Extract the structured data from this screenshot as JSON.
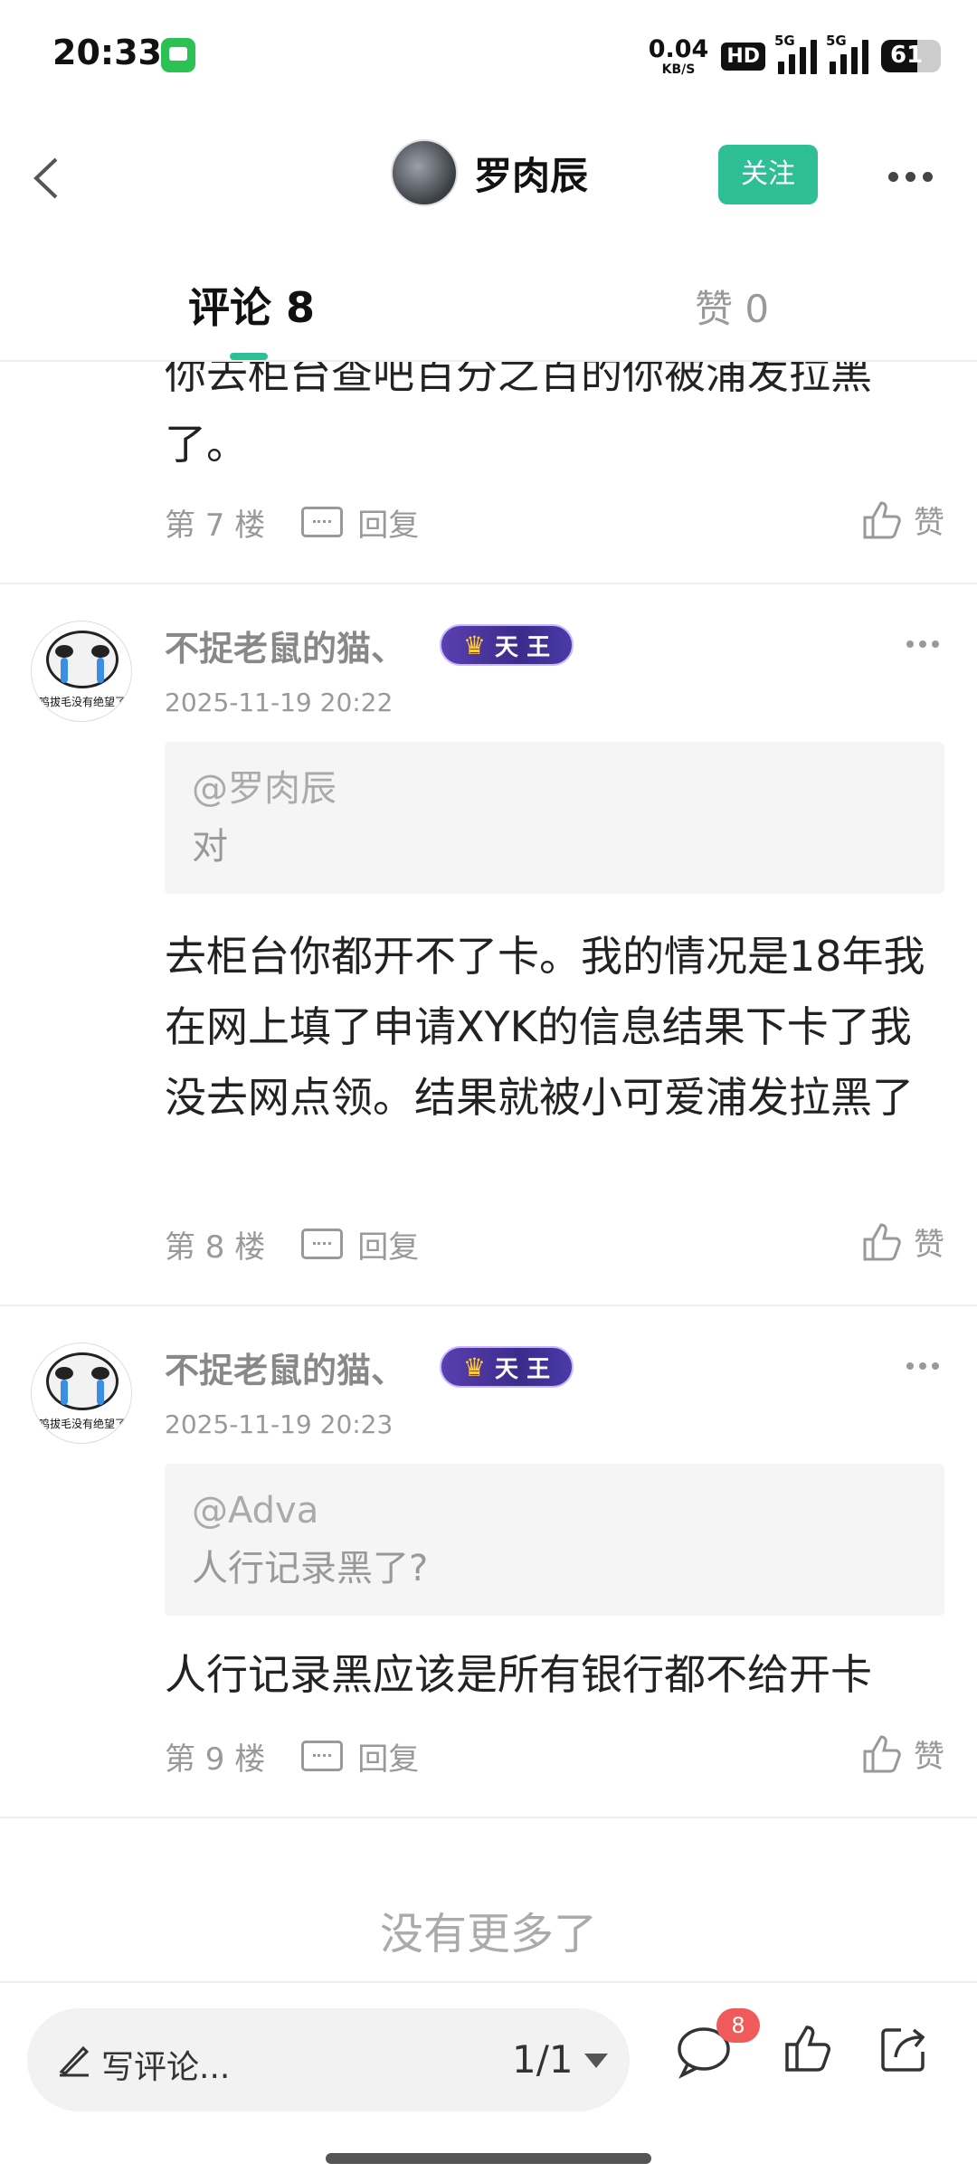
{
  "status_bar": {
    "time": "20:33",
    "net_speed": "0.04",
    "net_unit": "KB/S",
    "hd": "HD",
    "sim1": "5G",
    "sim2": "5G",
    "battery": "61",
    "battery_level": 0.61
  },
  "header": {
    "username": "罗肉辰",
    "follow_label": "关注"
  },
  "tabs": {
    "comments": "评论 8",
    "likes": "赞 0"
  },
  "comments": [
    {
      "body_partial": "你去柜台查吧百分之百的你被浦发拉黑了。",
      "floor": "第 7 楼",
      "reply_label": "回复",
      "like_label": "赞"
    },
    {
      "author": "不捉老鼠的猫、",
      "badge": "天 王",
      "date": "2025-11-19 20:22",
      "quote_user": "@罗肉辰",
      "quote_text": "对",
      "body": "去柜台你都开不了卡。我的情况是18年我在网上填了申请XYK的信息结果下卡了我没去网点领。结果就被小可爱浦发拉黑了",
      "floor": "第 8 楼",
      "reply_label": "回复",
      "like_label": "赞",
      "avatar_caption": "鸣拔毛没有绝望了"
    },
    {
      "author": "不捉老鼠的猫、",
      "badge": "天 王",
      "date": "2025-11-19 20:23",
      "quote_user": "@Adva",
      "quote_text": "人行记录黑了?",
      "body": "人行记录黑应该是所有银行都不给开卡",
      "floor": "第 9 楼",
      "reply_label": "回复",
      "like_label": "赞",
      "avatar_caption": "鸣拔毛没有绝望了"
    }
  ],
  "footer": {
    "no_more": "没有更多了"
  },
  "bottom_bar": {
    "placeholder": "写评论...",
    "page": "1/1",
    "comment_count": "8"
  },
  "colors": {
    "accent": "#2fbf96",
    "badge_red": "#f05a5a"
  }
}
